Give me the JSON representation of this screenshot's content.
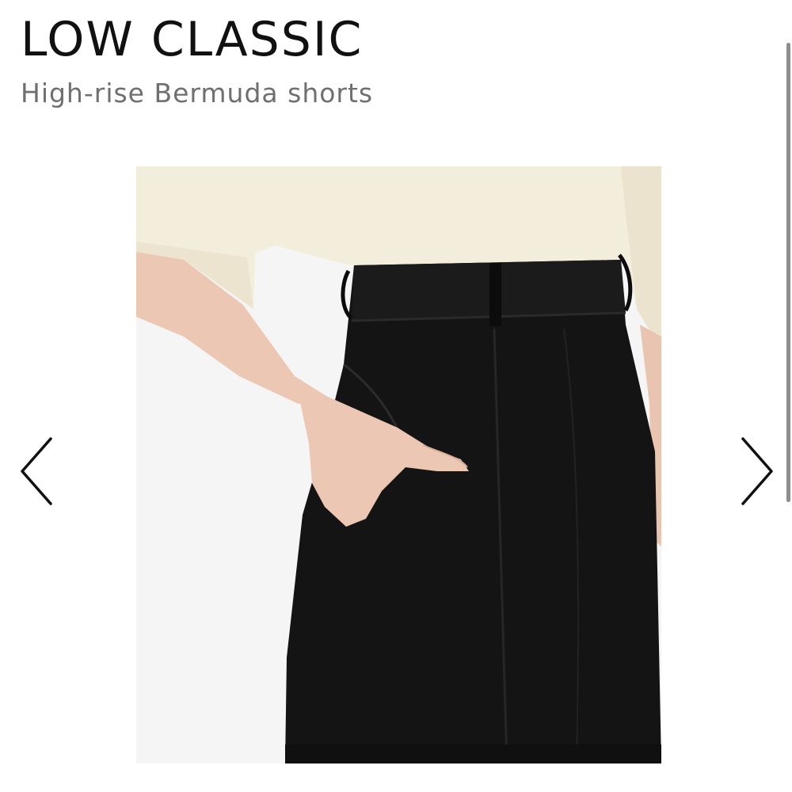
{
  "product": {
    "brand": "LOW CLASSIC",
    "name": "High-rise Bermuda shorts"
  },
  "gallery": {
    "image_alt": "High-rise Bermuda shorts",
    "prev_icon": "chevron-left-icon",
    "next_icon": "chevron-right-icon"
  },
  "colors": {
    "brand_text": "#111111",
    "name_text": "#6f6f6f",
    "shorts": "#141414",
    "top": "#f3eddc"
  }
}
